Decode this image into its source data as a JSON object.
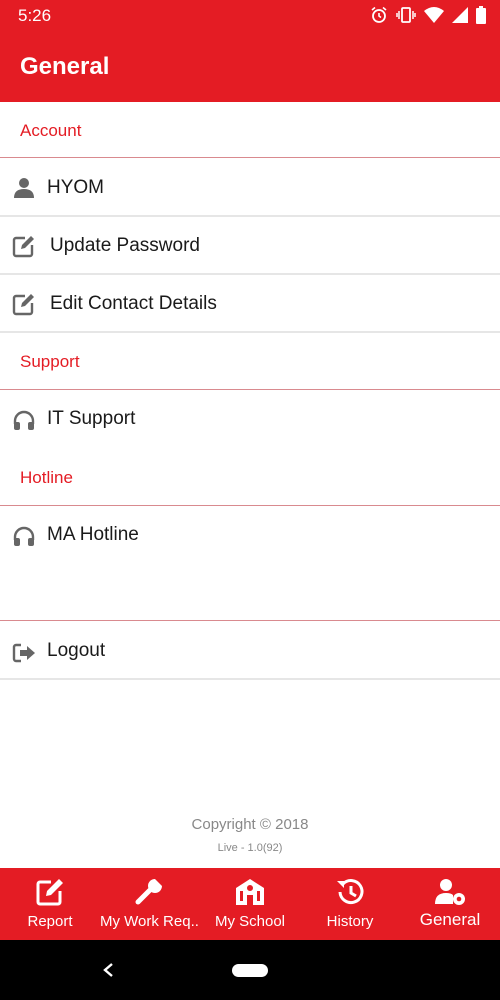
{
  "status_bar": {
    "time": "5:26",
    "icons": [
      "alarm-icon",
      "vibrate-icon",
      "wifi-icon",
      "cell-signal-icon",
      "battery-icon"
    ]
  },
  "app_bar": {
    "title": "General"
  },
  "sections": {
    "account": "Account",
    "support": "Support",
    "hotline": "Hotline"
  },
  "items": {
    "user": {
      "label": "HYOM",
      "icon": "user-icon"
    },
    "update_password": {
      "label": "Update Password",
      "icon": "edit-icon"
    },
    "edit_contact": {
      "label": "Edit Contact Details",
      "icon": "edit-icon"
    },
    "it_support": {
      "label": "IT Support",
      "icon": "headset-icon"
    },
    "ma_hotline": {
      "label": "MA Hotline",
      "icon": "headset-icon"
    },
    "logout": {
      "label": "Logout",
      "icon": "logout-icon"
    }
  },
  "footer": {
    "copyright": "Copyright © 2018",
    "version": "Live - 1.0(92)"
  },
  "bottom_nav": {
    "report": "Report",
    "work_requests": "My Work Req...",
    "school": "My School",
    "history": "History",
    "general": "General"
  },
  "colors": {
    "brand": "#e41c24",
    "divider_red": "#d98a8f",
    "divider_grey": "#e6e6e6",
    "icon_grey": "#666666"
  }
}
